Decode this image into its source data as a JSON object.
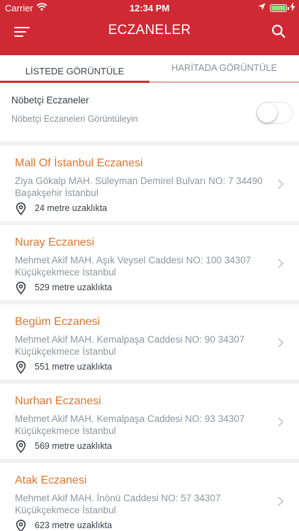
{
  "status_bar": {
    "carrier": "Carrier",
    "time": "12:34 PM"
  },
  "navbar": {
    "title": "ECZANELER",
    "color": "#cf2a34"
  },
  "tabs": [
    {
      "label": "LİSTEDE GÖRÜNTÜLE",
      "active": true
    },
    {
      "label": "HARİTADA GÖRÜNTÜLE",
      "active": false
    }
  ],
  "duty_filter": {
    "title": "Nöbetçi Eczaneler",
    "subtitle": "Nöbetçi Eczaneleri Görüntüleyin",
    "enabled": false
  },
  "pharmacies": [
    {
      "name": "Mall Of İstanbul Eczanesi",
      "address": "Ziya Gökalp MAH. Süleyman Demirel Bulvarı NO: 7 34490 Başakşehir İstanbul",
      "distance": "24 metre uzaklıkta"
    },
    {
      "name": "Nuray Eczanesi",
      "address": "Mehmet Akif MAH. Aşık Veysel Caddesi NO: 100 34307 Küçükçekmece İstanbul",
      "distance": "529 metre uzaklıkta"
    },
    {
      "name": "Begüm Eczanesi",
      "address": "Mehmet Akif MAH. Kemalpaşa Caddesi NO: 90 34307 Küçükçekmece İstanbul",
      "distance": "551 metre uzaklıkta"
    },
    {
      "name": "Nurhan Eczanesi",
      "address": "Mehmet Akif MAH. Kemalpaşa Caddesi NO: 93 34307 Küçükçekmece İstanbul",
      "distance": "569 metre uzaklıkta"
    },
    {
      "name": "Atak Eczanesi",
      "address": "Mehmet Akif MAH. İnönü Caddesi NO: 57 34307 Küçükçekmece İstanbul",
      "distance": "623 metre uzaklıkta"
    }
  ]
}
